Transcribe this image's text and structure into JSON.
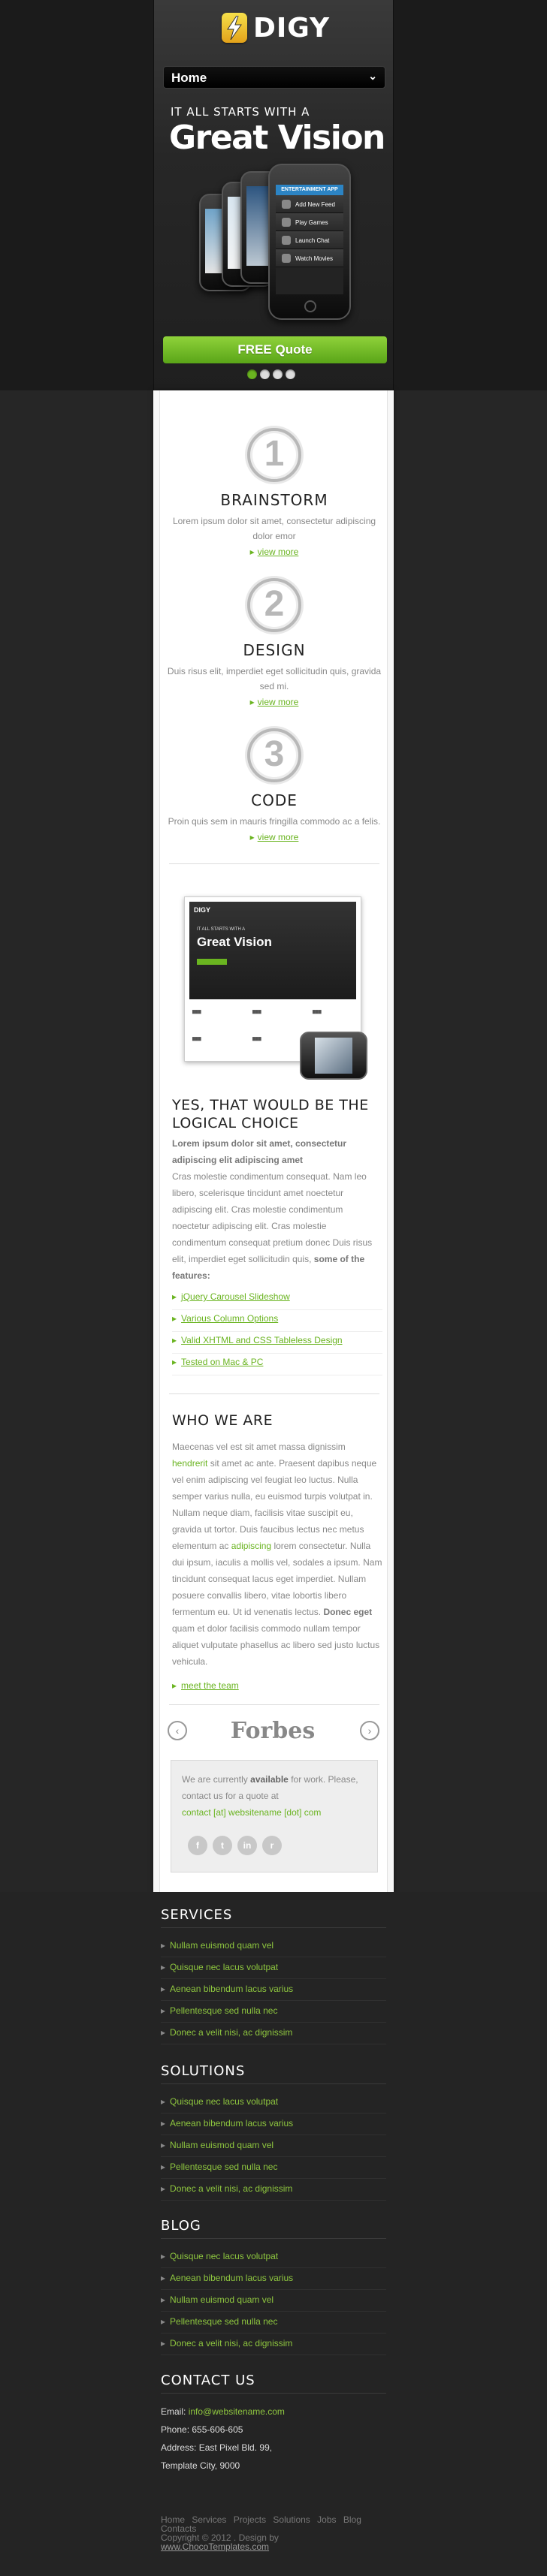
{
  "header": {
    "logo_text": "DIGY",
    "nav_selected": "Home",
    "hero_small": "IT ALL STARTS WITH A",
    "hero_big": "Great Vision",
    "app_title": "ENTERTAINMENT APP",
    "app_rows": [
      "Add New Feed",
      "Play Games",
      "Launch Chat",
      "Watch Movies"
    ],
    "quote_button": "FREE Quote",
    "slider_dots": 4,
    "slider_active": 1
  },
  "services": [
    {
      "number": "1",
      "title": "BRAINSTORM",
      "text": "Lorem ipsum dolor sit amet, consectetur adipiscing dolor emor",
      "more": "view more"
    },
    {
      "number": "2",
      "title": "DESIGN",
      "text": "Duis risus elit, imperdiet eget sollicitudin quis, gravida sed mi.",
      "more": "view more"
    },
    {
      "number": "3",
      "title": "CODE",
      "text": "Proin quis sem in mauris fringilla commodo ac a felis.",
      "more": "view more"
    }
  ],
  "showcase": {
    "shot_logo": "DIGY",
    "shot_tag": "IT ALL STARTS WITH A",
    "shot_title": "Great Vision"
  },
  "choice": {
    "title": "YES, THAT WOULD BE THE LOGICAL CHOICE",
    "lead_bold": "Lorem ipsum dolor sit amet, consectetur adipiscing elit adipiscing amet",
    "body": "Cras molestie condimentum consequat. Nam leo libero, scelerisque tincidunt amet noectetur adipiscing elit. Cras molestie condimentum noectetur adipiscing elit. Cras molestie condimentum consequat pretium donec Duis risus elit, imperdiet eget sollicitudin quis,",
    "features_bold": "some of the features:",
    "features": [
      "jQuery Carousel Slideshow",
      "Various Column Options",
      "Valid XHTML and CSS Tableless Design",
      "Tested on Mac & PC"
    ]
  },
  "who": {
    "title": "WHO WE ARE",
    "p1": "Maecenas vel est sit amet massa dignissim",
    "p1_link": "hendrerit",
    "p2": "sit amet ac ante. Praesent dapibus neque vel enim adipiscing vel feugiat leo luctus. Nulla semper varius nulla, eu euismod turpis volutpat in. Nullam neque diam, facilisis vitae suscipit eu, gravida ut tortor. Duis faucibus lectus nec metus elementum ac",
    "p2_link": "adipiscing",
    "p3": "lorem consectetur. Nulla dui ipsum, iaculis a mollis vel, sodales a ipsum. Nam tincidunt consequat lacus eget imperdiet. Nullam posuere convallis libero, vitae lobortis libero fermentum eu. Ut id venenatis lectus.",
    "p3_bold": "Donec eget",
    "p4": "quam et dolor facilisis commodo nullam tempor aliquet vulputate phasellus ac libero sed justo luctus vehicula.",
    "link": "meet the team"
  },
  "forbes": {
    "logo": "Forbes",
    "prev": "‹",
    "next": "›"
  },
  "availability": {
    "line1": "We are currently",
    "available": "available",
    "line2": "for work. Please, contact us for a quote at",
    "email": "contact [at] websitename [dot] com",
    "social_icons": [
      "f",
      "t",
      "in",
      "r"
    ]
  },
  "footer": {
    "services_title": "SERVICES",
    "services": [
      "Nullam euismod quam vel",
      "Quisque nec lacus volutpat",
      "Aenean bibendum lacus varius",
      "Pellentesque sed nulla nec",
      "Donec a velit nisi, ac dignissim"
    ],
    "solutions_title": "SOLUTIONS",
    "solutions": [
      "Quisque nec lacus volutpat",
      "Aenean bibendum lacus varius",
      "Nullam euismod quam vel",
      "Pellentesque sed nulla nec",
      "Donec a velit nisi, ac dignissim"
    ],
    "blog_title": "BLOG",
    "blog": [
      "Quisque nec lacus volutpat",
      "Aenean bibendum lacus varius",
      "Nullam euismod quam vel",
      "Pellentesque sed nulla nec",
      "Donec a velit nisi, ac dignissim"
    ],
    "contact_title": "CONTACT US",
    "email_label": "Email:",
    "email": "info@websitename.com",
    "phone": "Phone: 655-606-605",
    "address1": "Address: East Pixel Bld. 99,",
    "address2": "Template City, 9000",
    "nav": [
      "Home",
      "Services",
      "Projects",
      "Solutions",
      "Jobs",
      "Blog",
      "Contacts"
    ],
    "copyright": "Copyright © 2012 . Design by",
    "designer": "www.ChocoTemplates.com"
  },
  "colors": {
    "accent": "#6ab420",
    "dark": "#242424"
  }
}
